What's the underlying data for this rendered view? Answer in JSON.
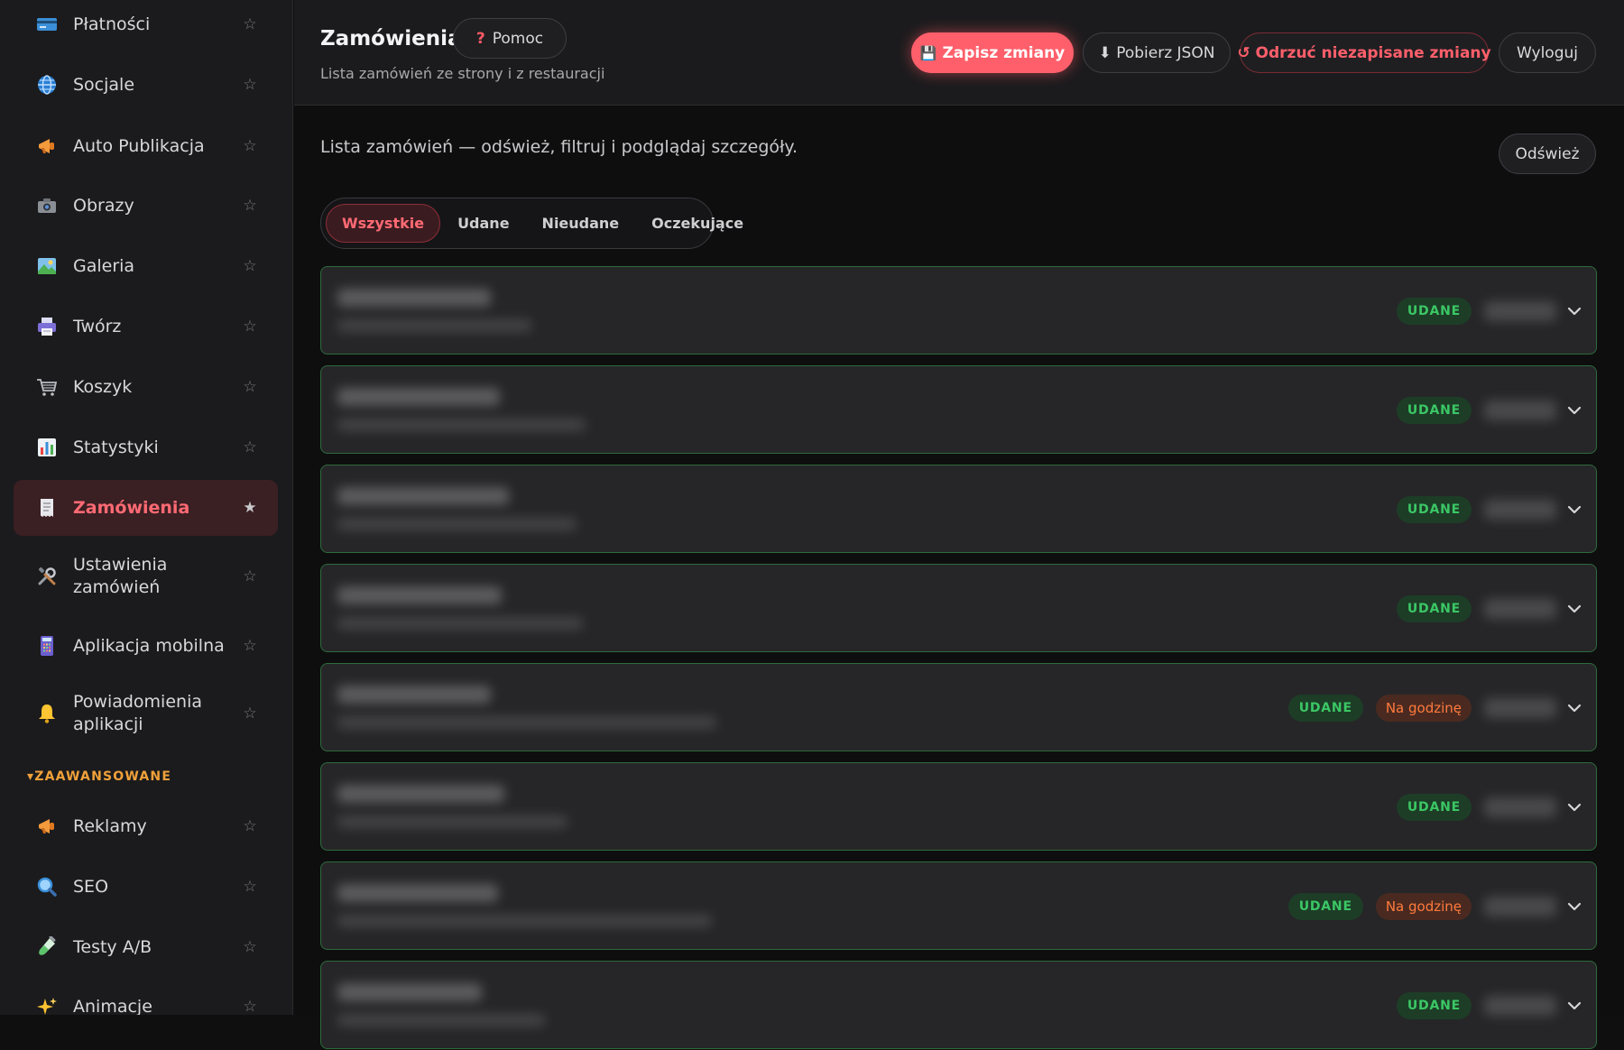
{
  "sidebar": {
    "items": [
      {
        "label": "Płatności",
        "icon": "credit-card-icon",
        "star": "☆"
      },
      {
        "label": "Socjale",
        "icon": "globe-icon",
        "star": "☆"
      },
      {
        "label": "Auto Publikacja",
        "icon": "megaphone-icon",
        "star": "☆"
      },
      {
        "label": "Obrazy",
        "icon": "camera-icon",
        "star": "☆"
      },
      {
        "label": "Galeria",
        "icon": "picture-icon",
        "star": "☆"
      },
      {
        "label": "Twórz",
        "icon": "printer-icon",
        "star": "☆"
      },
      {
        "label": "Koszyk",
        "icon": "cart-icon",
        "star": "☆"
      },
      {
        "label": "Statystyki",
        "icon": "bar-chart-icon",
        "star": "☆"
      },
      {
        "label": "Zamówienia",
        "icon": "receipt-icon",
        "star": "★"
      },
      {
        "label_line1": "Ustawienia",
        "label_line2": "zamówień",
        "icon": "tools-icon",
        "star": "☆"
      },
      {
        "label": "Aplikacja mobilna",
        "icon": "calculator-icon",
        "star": "☆"
      },
      {
        "label_line1": "Powiadomienia",
        "label_line2": "aplikacji",
        "icon": "bell-icon",
        "star": "☆"
      },
      {
        "label": "Reklamy",
        "icon": "megaphone-icon",
        "star": "☆"
      },
      {
        "label": "SEO",
        "icon": "magnifier-icon",
        "star": "☆"
      },
      {
        "label": "Testy A/B",
        "icon": "test-tube-icon",
        "star": "☆"
      },
      {
        "label": "Animacje",
        "icon": "sparkles-icon",
        "star": "☆"
      }
    ],
    "section_advanced": "▾ZAAWANSOWANE",
    "active_index": 8
  },
  "header": {
    "title": "Zamówienia",
    "help_icon": "?",
    "help_label": "Pomoc",
    "subtitle": "Lista zamówień ze strony i z restauracji",
    "save_icon": "💾",
    "save_label": "Zapisz zmiany",
    "json_label": "⬇ Pobierz JSON",
    "discard_label": "↺ Odrzuć niezapisane zmiany",
    "logout_label": "Wyloguj"
  },
  "content": {
    "description": "Lista zamówień — odśwież, filtruj i podglądaj szczegóły.",
    "refresh_label": "Odśwież",
    "tabs": [
      "Wszystkie",
      "Udane",
      "Nieudane",
      "Oczekujące"
    ],
    "active_tab": 0
  },
  "orders": [
    {
      "status": "UDANE",
      "schedule": ""
    },
    {
      "status": "UDANE",
      "schedule": ""
    },
    {
      "status": "UDANE",
      "schedule": ""
    },
    {
      "status": "UDANE",
      "schedule": ""
    },
    {
      "status": "UDANE",
      "schedule": "Na godzinę"
    },
    {
      "status": "UDANE",
      "schedule": ""
    },
    {
      "status": "UDANE",
      "schedule": "Na godzinę"
    },
    {
      "status": "UDANE",
      "schedule": ""
    }
  ],
  "colors": {
    "accent": "#ff5f6b",
    "success": "#3bc765",
    "warning": "#ff7a3d",
    "section_heading": "#f0a13a"
  }
}
